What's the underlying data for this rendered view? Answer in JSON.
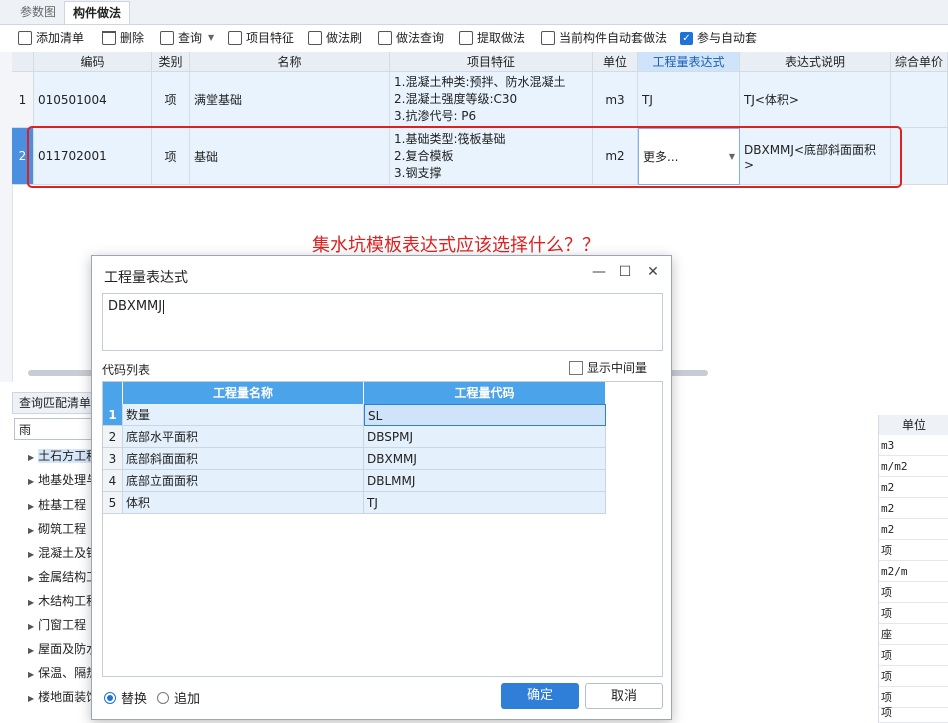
{
  "tabs": [
    "参数图",
    "构件做法"
  ],
  "toolbar": {
    "add": "添加清单",
    "delete": "删除",
    "query": "查询",
    "feature": "项目特征",
    "brush": "做法刷",
    "method_query": "做法查询",
    "extract": "提取做法",
    "auto_method": "当前构件自动套做法",
    "auto_participate": "参与自动套"
  },
  "grid": {
    "headers": [
      "编码",
      "类别",
      "名称",
      "项目特征",
      "单位",
      "工程量表达式",
      "表达式说明",
      "综合单价"
    ],
    "rows": [
      {
        "num": "1",
        "code": "010501004",
        "type": "项",
        "name": "满堂基础",
        "features": [
          "1.混凝土种类:预拌、防水混凝土",
          "2.混凝土强度等级:C30",
          "3.抗渗代号: P6"
        ],
        "unit": "m3",
        "expr": "TJ",
        "desc": "TJ<体积>"
      },
      {
        "num": "2",
        "code": "011702001",
        "type": "项",
        "name": "基础",
        "features": [
          "1.基础类型:筏板基础",
          "2.复合模板",
          "3.钢支撑"
        ],
        "unit": "m2",
        "expr": "更多...",
        "desc": "DBXMMJ<底部斜面面积>"
      }
    ]
  },
  "question": "集水坑模板表达式应该选择什么？？",
  "lower": {
    "panel_title": "查询匹配清单",
    "search_value": "雨",
    "unit_header": "单位",
    "tree": [
      "土石方工程",
      "地基处理与",
      "桩基工程",
      "砌筑工程",
      "混凝土及钢",
      "金属结构工",
      "木结构工程",
      "门窗工程",
      "屋面及防水",
      "保温、隔热",
      "楼地面装饰"
    ],
    "units": [
      "m3",
      "m/m2",
      "m2",
      "m2",
      "m2",
      "项",
      "m2/m",
      "项",
      "项",
      "座",
      "项",
      "项",
      "项",
      "项"
    ]
  },
  "dialog": {
    "title": "工程量表达式",
    "expression": "DBXMMJ",
    "code_list_label": "代码列表",
    "show_intermediate": "显示中间量",
    "col_name": "工程量名称",
    "col_code": "工程量代码",
    "items": [
      {
        "num": "1",
        "name": "数量",
        "code": "SL"
      },
      {
        "num": "2",
        "name": "底部水平面积",
        "code": "DBSPMJ"
      },
      {
        "num": "3",
        "name": "底部斜面面积",
        "code": "DBXMMJ"
      },
      {
        "num": "4",
        "name": "底部立面面积",
        "code": "DBLMMJ"
      },
      {
        "num": "5",
        "name": "体积",
        "code": "TJ"
      }
    ],
    "replace": "替换",
    "append": "追加",
    "ok": "确定",
    "cancel": "取消"
  },
  "colors": {
    "accent": "#2f7ed8",
    "header_blue": "#4ba3ea",
    "alert_red": "#e02020"
  }
}
